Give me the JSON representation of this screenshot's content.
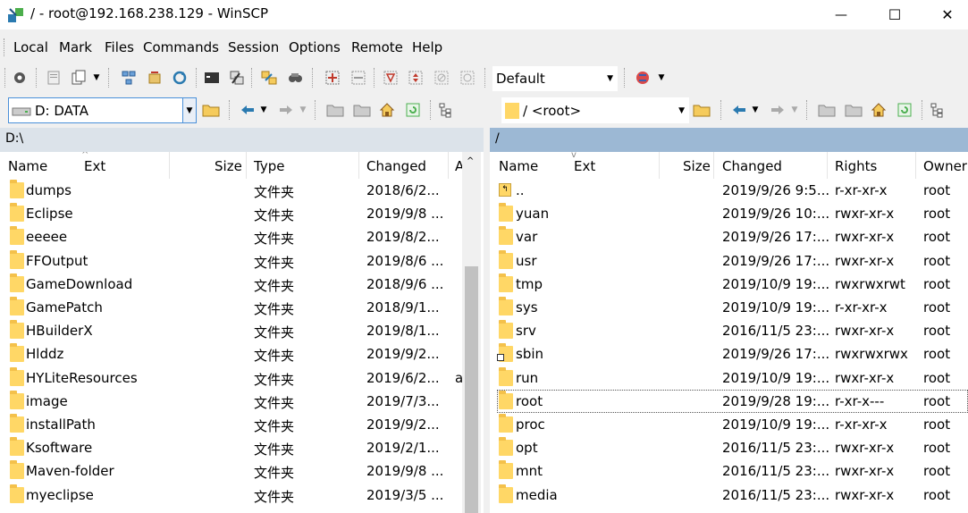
{
  "window": {
    "title": "/ - root@192.168.238.129 - WinSCP",
    "minimize_glyph": "—",
    "maximize_glyph": "☐",
    "close_glyph": "✕"
  },
  "menu": [
    "Local",
    "Mark",
    "Files",
    "Commands",
    "Session",
    "Options",
    "Remote",
    "Help"
  ],
  "toolbar": {
    "transfer_profile": "Default"
  },
  "left_panel": {
    "drive": "D: DATA",
    "path": "D:\\",
    "columns": [
      "Name",
      "Ext",
      "Size",
      "Type",
      "Changed",
      "A"
    ],
    "rows": [
      {
        "name": "dumps",
        "type": "文件夹",
        "changed": "2018/6/2...",
        "attr": ""
      },
      {
        "name": "Eclipse",
        "type": "文件夹",
        "changed": "2019/9/8 ...",
        "attr": ""
      },
      {
        "name": "eeeee",
        "type": "文件夹",
        "changed": "2019/8/2...",
        "attr": ""
      },
      {
        "name": "FFOutput",
        "type": "文件夹",
        "changed": "2019/8/6 ...",
        "attr": ""
      },
      {
        "name": "GameDownload",
        "type": "文件夹",
        "changed": "2018/9/6 ...",
        "attr": ""
      },
      {
        "name": "GamePatch",
        "type": "文件夹",
        "changed": "2018/9/1...",
        "attr": ""
      },
      {
        "name": "HBuilderX",
        "type": "文件夹",
        "changed": "2019/8/1...",
        "attr": ""
      },
      {
        "name": "Hlddz",
        "type": "文件夹",
        "changed": "2019/9/2...",
        "attr": ""
      },
      {
        "name": "HYLiteResources",
        "type": "文件夹",
        "changed": "2019/6/2...",
        "attr": "a"
      },
      {
        "name": "image",
        "type": "文件夹",
        "changed": "2019/7/3...",
        "attr": ""
      },
      {
        "name": "installPath",
        "type": "文件夹",
        "changed": "2019/9/2...",
        "attr": ""
      },
      {
        "name": "Ksoftware",
        "type": "文件夹",
        "changed": "2019/2/1...",
        "attr": ""
      },
      {
        "name": "Maven-folder",
        "type": "文件夹",
        "changed": "2019/9/8 ...",
        "attr": ""
      },
      {
        "name": "myeclipse",
        "type": "文件夹",
        "changed": "2019/3/5 ...",
        "attr": ""
      }
    ]
  },
  "right_panel": {
    "directory": "/ <root>",
    "path": "/",
    "columns": [
      "Name",
      "Ext",
      "Size",
      "Changed",
      "Rights",
      "Owner"
    ],
    "rows": [
      {
        "name": "..",
        "changed": "2019/9/26 9:5...",
        "rights": "r-xr-xr-x",
        "owner": "root"
      },
      {
        "name": "yuan",
        "changed": "2019/9/26 10:...",
        "rights": "rwxr-xr-x",
        "owner": "root"
      },
      {
        "name": "var",
        "changed": "2019/9/26 17:...",
        "rights": "rwxr-xr-x",
        "owner": "root"
      },
      {
        "name": "usr",
        "changed": "2019/9/26 17:...",
        "rights": "rwxr-xr-x",
        "owner": "root"
      },
      {
        "name": "tmp",
        "changed": "2019/10/9 19:...",
        "rights": "rwxrwxrwt",
        "owner": "root"
      },
      {
        "name": "sys",
        "changed": "2019/10/9 19:...",
        "rights": "r-xr-xr-x",
        "owner": "root"
      },
      {
        "name": "srv",
        "changed": "2016/11/5 23:...",
        "rights": "rwxr-xr-x",
        "owner": "root"
      },
      {
        "name": "sbin",
        "changed": "2019/9/26 17:...",
        "rights": "rwxrwxrwx",
        "owner": "root"
      },
      {
        "name": "run",
        "changed": "2019/10/9 19:...",
        "rights": "rwxr-xr-x",
        "owner": "root"
      },
      {
        "name": "root",
        "changed": "2019/9/28 19:...",
        "rights": "r-xr-x---",
        "owner": "root"
      },
      {
        "name": "proc",
        "changed": "2019/10/9 19:...",
        "rights": "r-xr-xr-x",
        "owner": "root"
      },
      {
        "name": "opt",
        "changed": "2016/11/5 23:...",
        "rights": "rwxr-xr-x",
        "owner": "root"
      },
      {
        "name": "mnt",
        "changed": "2016/11/5 23:...",
        "rights": "rwxr-xr-x",
        "owner": "root"
      },
      {
        "name": "media",
        "changed": "2016/11/5 23:...",
        "rights": "rwxr-xr-x",
        "owner": "root"
      }
    ]
  }
}
